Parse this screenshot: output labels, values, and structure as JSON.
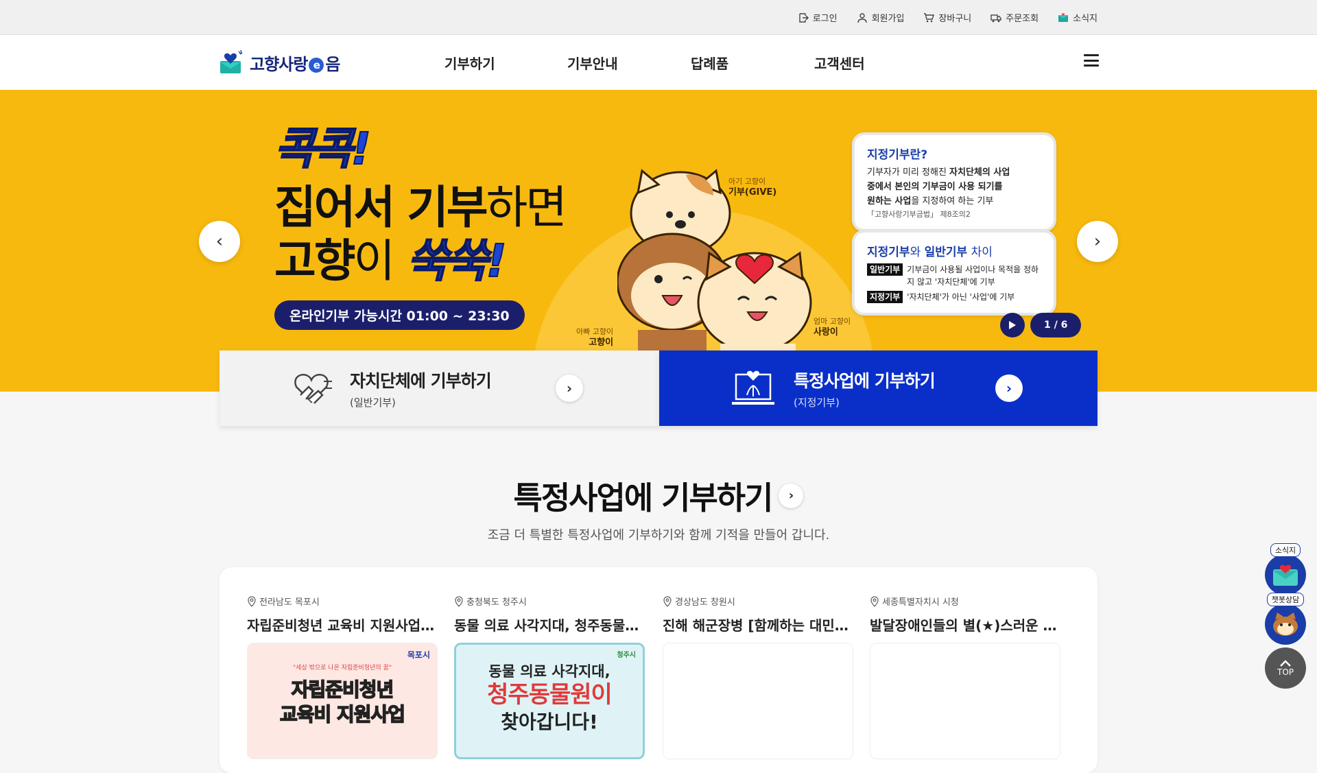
{
  "utility": {
    "login": "로그인",
    "signup": "회원가입",
    "cart": "장바구니",
    "orders": "주문조회",
    "news": "소식지"
  },
  "header": {
    "logo_main": "고향사랑",
    "logo_mark": "e",
    "logo_end": "음",
    "menu": [
      "기부하기",
      "기부안내",
      "답례품",
      "고객센터"
    ]
  },
  "hero": {
    "tag": "콕콕!",
    "line1_bold": "집어서 기부",
    "line1_thin": "하면",
    "line2_bold": "고향",
    "line2_thin": "이",
    "line2_hl": "쑥쑥!",
    "pill": "온라인기부 가능시간 01:00 ~ 23:30",
    "characters": {
      "baby_sub": "아기 고향이",
      "baby_name": "기부(GIVE)",
      "dad_sub": "아빠 고향이",
      "dad_name": "고향이",
      "mom_sub": "엄마 고향이",
      "mom_name": "사랑이"
    },
    "info1": {
      "title": "지정기부란?",
      "p1": "기부자가 미리 정해진 ",
      "p1b": "자치단체의 사업",
      "p2b": "중에서 본인의 기부금이 사용 되기를",
      "p3b": "원하는 사업",
      "p3": "을 지정하여 하는 기부",
      "ref": "「고향사랑기부금법」 제8조의2"
    },
    "info2": {
      "title_a": "지정기부",
      "title_b": "와 ",
      "title_c": "일반기부",
      "title_d": " 차이",
      "k1": "일반기부",
      "v1": "기부금이 사용될 사업이나 목적을 정하지 않고 '자치단체'에 기부",
      "k2": "지정기부",
      "v2": "'자치단체'가 아닌 '사업'에 기부"
    },
    "counter": "1 / 6"
  },
  "donate": {
    "general_title": "자치단체에 기부하기",
    "general_sub": "(일반기부)",
    "designated_title": "특정사업에 기부하기",
    "designated_sub": "(지정기부)"
  },
  "section": {
    "title": "특정사업에 기부하기",
    "subtitle": "조금 더 특별한 특정사업에 기부하기와 함께 기적을 만들어 갑니다."
  },
  "cards": [
    {
      "location": "전라남도 목포시",
      "title": "자립준비청년 교육비 지원사업(…",
      "thumb_brand": "목포시",
      "thumb_quote": "\"세상 밖으로 나온 자립준비청년의 꿈\"",
      "thumb_line1": "자립준비청년",
      "thumb_line2": "교육비 지원사업"
    },
    {
      "location": "충청북도 청주시",
      "title": "동물 의료 사각지대, 청주동물…",
      "thumb_brand": "청주시",
      "thumb_line1": "동물 의료 사각지대,",
      "thumb_line2": "청주동물원이",
      "thumb_line3": "찾아갑니다!"
    },
    {
      "location": "경상남도 창원시",
      "title": "진해 해군장병 [함께하는 대민…"
    },
    {
      "location": "세종특별자치시 시청",
      "title": "발달장애인들의 별(★)스러운 …"
    }
  ],
  "floating": {
    "news": "소식지",
    "chatbot": "챗봇상담",
    "top": "TOP"
  },
  "colors": {
    "hero_bg": "#f8b90f",
    "primary": "#0a2fc9",
    "navy": "#1b1f6b"
  }
}
